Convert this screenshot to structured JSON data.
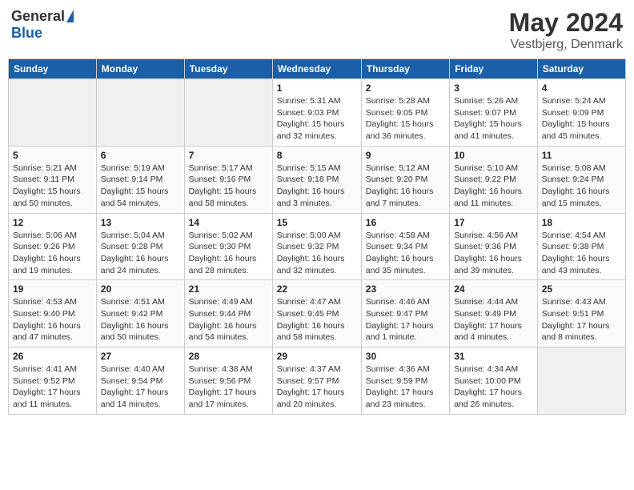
{
  "header": {
    "logo_general": "General",
    "logo_blue": "Blue",
    "title": "May 2024",
    "location": "Vestbjerg, Denmark"
  },
  "weekdays": [
    "Sunday",
    "Monday",
    "Tuesday",
    "Wednesday",
    "Thursday",
    "Friday",
    "Saturday"
  ],
  "weeks": [
    [
      {
        "day": "",
        "sunrise": "",
        "sunset": "",
        "daylight": "",
        "empty": true
      },
      {
        "day": "",
        "sunrise": "",
        "sunset": "",
        "daylight": "",
        "empty": true
      },
      {
        "day": "",
        "sunrise": "",
        "sunset": "",
        "daylight": "",
        "empty": true
      },
      {
        "day": "1",
        "sunrise": "Sunrise: 5:31 AM",
        "sunset": "Sunset: 9:03 PM",
        "daylight": "Daylight: 15 hours and 32 minutes."
      },
      {
        "day": "2",
        "sunrise": "Sunrise: 5:28 AM",
        "sunset": "Sunset: 9:05 PM",
        "daylight": "Daylight: 15 hours and 36 minutes."
      },
      {
        "day": "3",
        "sunrise": "Sunrise: 5:26 AM",
        "sunset": "Sunset: 9:07 PM",
        "daylight": "Daylight: 15 hours and 41 minutes."
      },
      {
        "day": "4",
        "sunrise": "Sunrise: 5:24 AM",
        "sunset": "Sunset: 9:09 PM",
        "daylight": "Daylight: 15 hours and 45 minutes."
      }
    ],
    [
      {
        "day": "5",
        "sunrise": "Sunrise: 5:21 AM",
        "sunset": "Sunset: 9:11 PM",
        "daylight": "Daylight: 15 hours and 50 minutes."
      },
      {
        "day": "6",
        "sunrise": "Sunrise: 5:19 AM",
        "sunset": "Sunset: 9:14 PM",
        "daylight": "Daylight: 15 hours and 54 minutes."
      },
      {
        "day": "7",
        "sunrise": "Sunrise: 5:17 AM",
        "sunset": "Sunset: 9:16 PM",
        "daylight": "Daylight: 15 hours and 58 minutes."
      },
      {
        "day": "8",
        "sunrise": "Sunrise: 5:15 AM",
        "sunset": "Sunset: 9:18 PM",
        "daylight": "Daylight: 16 hours and 3 minutes."
      },
      {
        "day": "9",
        "sunrise": "Sunrise: 5:12 AM",
        "sunset": "Sunset: 9:20 PM",
        "daylight": "Daylight: 16 hours and 7 minutes."
      },
      {
        "day": "10",
        "sunrise": "Sunrise: 5:10 AM",
        "sunset": "Sunset: 9:22 PM",
        "daylight": "Daylight: 16 hours and 11 minutes."
      },
      {
        "day": "11",
        "sunrise": "Sunrise: 5:08 AM",
        "sunset": "Sunset: 9:24 PM",
        "daylight": "Daylight: 16 hours and 15 minutes."
      }
    ],
    [
      {
        "day": "12",
        "sunrise": "Sunrise: 5:06 AM",
        "sunset": "Sunset: 9:26 PM",
        "daylight": "Daylight: 16 hours and 19 minutes."
      },
      {
        "day": "13",
        "sunrise": "Sunrise: 5:04 AM",
        "sunset": "Sunset: 9:28 PM",
        "daylight": "Daylight: 16 hours and 24 minutes."
      },
      {
        "day": "14",
        "sunrise": "Sunrise: 5:02 AM",
        "sunset": "Sunset: 9:30 PM",
        "daylight": "Daylight: 16 hours and 28 minutes."
      },
      {
        "day": "15",
        "sunrise": "Sunrise: 5:00 AM",
        "sunset": "Sunset: 9:32 PM",
        "daylight": "Daylight: 16 hours and 32 minutes."
      },
      {
        "day": "16",
        "sunrise": "Sunrise: 4:58 AM",
        "sunset": "Sunset: 9:34 PM",
        "daylight": "Daylight: 16 hours and 35 minutes."
      },
      {
        "day": "17",
        "sunrise": "Sunrise: 4:56 AM",
        "sunset": "Sunset: 9:36 PM",
        "daylight": "Daylight: 16 hours and 39 minutes."
      },
      {
        "day": "18",
        "sunrise": "Sunrise: 4:54 AM",
        "sunset": "Sunset: 9:38 PM",
        "daylight": "Daylight: 16 hours and 43 minutes."
      }
    ],
    [
      {
        "day": "19",
        "sunrise": "Sunrise: 4:53 AM",
        "sunset": "Sunset: 9:40 PM",
        "daylight": "Daylight: 16 hours and 47 minutes."
      },
      {
        "day": "20",
        "sunrise": "Sunrise: 4:51 AM",
        "sunset": "Sunset: 9:42 PM",
        "daylight": "Daylight: 16 hours and 50 minutes."
      },
      {
        "day": "21",
        "sunrise": "Sunrise: 4:49 AM",
        "sunset": "Sunset: 9:44 PM",
        "daylight": "Daylight: 16 hours and 54 minutes."
      },
      {
        "day": "22",
        "sunrise": "Sunrise: 4:47 AM",
        "sunset": "Sunset: 9:45 PM",
        "daylight": "Daylight: 16 hours and 58 minutes."
      },
      {
        "day": "23",
        "sunrise": "Sunrise: 4:46 AM",
        "sunset": "Sunset: 9:47 PM",
        "daylight": "Daylight: 17 hours and 1 minute."
      },
      {
        "day": "24",
        "sunrise": "Sunrise: 4:44 AM",
        "sunset": "Sunset: 9:49 PM",
        "daylight": "Daylight: 17 hours and 4 minutes."
      },
      {
        "day": "25",
        "sunrise": "Sunrise: 4:43 AM",
        "sunset": "Sunset: 9:51 PM",
        "daylight": "Daylight: 17 hours and 8 minutes."
      }
    ],
    [
      {
        "day": "26",
        "sunrise": "Sunrise: 4:41 AM",
        "sunset": "Sunset: 9:52 PM",
        "daylight": "Daylight: 17 hours and 11 minutes."
      },
      {
        "day": "27",
        "sunrise": "Sunrise: 4:40 AM",
        "sunset": "Sunset: 9:54 PM",
        "daylight": "Daylight: 17 hours and 14 minutes."
      },
      {
        "day": "28",
        "sunrise": "Sunrise: 4:38 AM",
        "sunset": "Sunset: 9:56 PM",
        "daylight": "Daylight: 17 hours and 17 minutes."
      },
      {
        "day": "29",
        "sunrise": "Sunrise: 4:37 AM",
        "sunset": "Sunset: 9:57 PM",
        "daylight": "Daylight: 17 hours and 20 minutes."
      },
      {
        "day": "30",
        "sunrise": "Sunrise: 4:36 AM",
        "sunset": "Sunset: 9:59 PM",
        "daylight": "Daylight: 17 hours and 23 minutes."
      },
      {
        "day": "31",
        "sunrise": "Sunrise: 4:34 AM",
        "sunset": "Sunset: 10:00 PM",
        "daylight": "Daylight: 17 hours and 26 minutes."
      },
      {
        "day": "",
        "sunrise": "",
        "sunset": "",
        "daylight": "",
        "empty": true
      }
    ]
  ]
}
